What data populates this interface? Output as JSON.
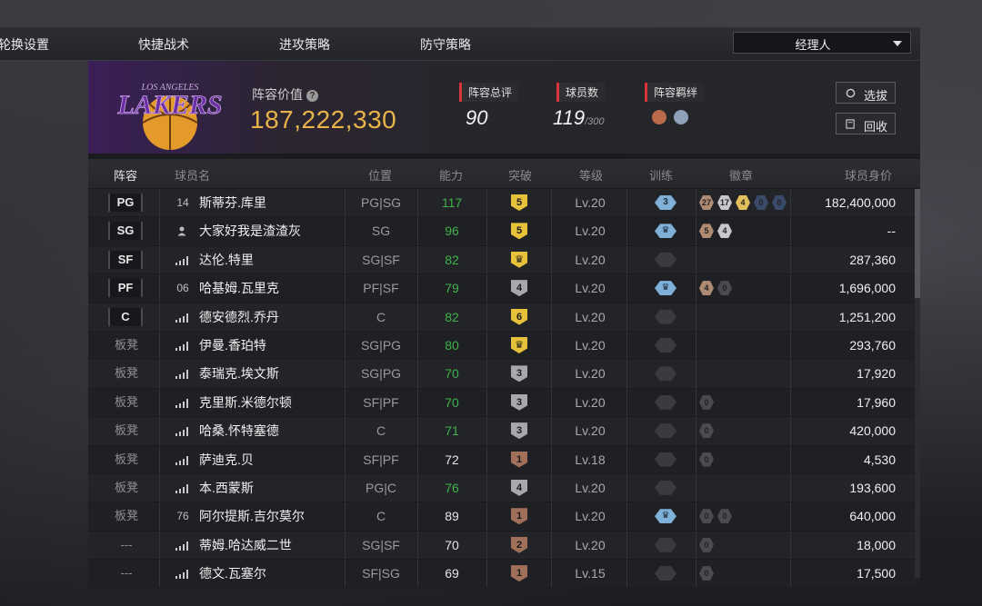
{
  "topnav": {
    "items": [
      "轮换设置",
      "快捷战术",
      "进攻策略",
      "防守策略"
    ],
    "manager_select": "经理人"
  },
  "team": {
    "logo_text": "LAKERS",
    "logo_subtext": "LOS ANGELES",
    "value_label": "阵容价值",
    "value": "187,222,330",
    "stats": [
      {
        "label": "阵容总评",
        "value": "90",
        "suffix": ""
      },
      {
        "label": "球员数",
        "value": "119",
        "suffix": "/300"
      },
      {
        "label": "阵容羁绊",
        "value": "",
        "suffix": ""
      }
    ],
    "buttons": {
      "select": "选拔",
      "recycle": "回收"
    }
  },
  "columns": [
    "阵容",
    "球员名",
    "位置",
    "能力",
    "突破",
    "等级",
    "训练",
    "徽章",
    "球员身价"
  ],
  "players": [
    {
      "slot": "PG",
      "starter": true,
      "icon": "jersey",
      "jersey": "14",
      "name": "斯蒂芬.库里",
      "position": "PG|SG",
      "ability": "117",
      "ability_color": "#3fb24a",
      "breakthrough": "5",
      "bt_color": "#e8c13a",
      "level": "Lv.20",
      "training": "3",
      "badges": [
        {
          "t": "27",
          "c": "#b08b74"
        },
        {
          "t": "17",
          "c": "#c8c8cc"
        },
        {
          "t": "4",
          "c": "#e3c05a"
        },
        {
          "t": "0",
          "c": "#3a4a6a"
        },
        {
          "t": "0",
          "c": "#3a4a6a"
        }
      ],
      "price": "182,400,000"
    },
    {
      "slot": "SG",
      "starter": true,
      "icon": "avatar",
      "jersey": "",
      "name": "大家好我是渣渣灰",
      "position": "SG",
      "ability": "96",
      "ability_color": "#3fb24a",
      "breakthrough": "5",
      "bt_color": "#e8c13a",
      "level": "Lv.20",
      "training": "crown",
      "badges": [
        {
          "t": "5",
          "c": "#b08b74"
        },
        {
          "t": "4",
          "c": "#c8c8cc"
        }
      ],
      "price": "--"
    },
    {
      "slot": "SF",
      "starter": true,
      "icon": "signal",
      "jersey": "",
      "name": "达伦.特里",
      "position": "SG|SF",
      "ability": "82",
      "ability_color": "#3fb24a",
      "breakthrough": "crown",
      "bt_color": "#e8c13a",
      "level": "Lv.20",
      "training": "none",
      "badges": [],
      "price": "287,360"
    },
    {
      "slot": "PF",
      "starter": true,
      "icon": "jersey",
      "jersey": "06",
      "name": "哈基姆.瓦里克",
      "position": "PF|SF",
      "ability": "79",
      "ability_color": "#3fb24a",
      "breakthrough": "4",
      "bt_color": "#a8a8ac",
      "level": "Lv.20",
      "training": "crown",
      "badges": [
        {
          "t": "4",
          "c": "#b08b74"
        },
        {
          "t": "0",
          "c": "#4a4b50"
        }
      ],
      "price": "1,696,000"
    },
    {
      "slot": "C",
      "starter": true,
      "icon": "signal",
      "jersey": "",
      "name": "德安德烈.乔丹",
      "position": "C",
      "ability": "82",
      "ability_color": "#3fb24a",
      "breakthrough": "6",
      "bt_color": "#e8c13a",
      "level": "Lv.20",
      "training": "none",
      "badges": [],
      "price": "1,251,200"
    },
    {
      "slot": "板凳",
      "starter": false,
      "icon": "signal",
      "jersey": "",
      "name": "伊曼.香珀特",
      "position": "SG|PG",
      "ability": "80",
      "ability_color": "#3fb24a",
      "breakthrough": "crown",
      "bt_color": "#e8c13a",
      "level": "Lv.20",
      "training": "none",
      "badges": [],
      "price": "293,760"
    },
    {
      "slot": "板凳",
      "starter": false,
      "icon": "signal",
      "jersey": "",
      "name": "泰瑞克.埃文斯",
      "position": "SG|PG",
      "ability": "70",
      "ability_color": "#3fb24a",
      "breakthrough": "3",
      "bt_color": "#a8a8ac",
      "level": "Lv.20",
      "training": "none",
      "badges": [],
      "price": "17,920"
    },
    {
      "slot": "板凳",
      "starter": false,
      "icon": "signal",
      "jersey": "",
      "name": "克里斯.米德尔顿",
      "position": "SF|PF",
      "ability": "70",
      "ability_color": "#3fb24a",
      "breakthrough": "3",
      "bt_color": "#a8a8ac",
      "level": "Lv.20",
      "training": "none",
      "badges": [
        {
          "t": "0",
          "c": "#4a4b50"
        }
      ],
      "price": "17,960"
    },
    {
      "slot": "板凳",
      "starter": false,
      "icon": "signal",
      "jersey": "",
      "name": "哈桑.怀特塞德",
      "position": "C",
      "ability": "71",
      "ability_color": "#3fb24a",
      "breakthrough": "3",
      "bt_color": "#a8a8ac",
      "level": "Lv.20",
      "training": "none",
      "badges": [
        {
          "t": "0",
          "c": "#4a4b50"
        }
      ],
      "price": "420,000"
    },
    {
      "slot": "板凳",
      "starter": false,
      "icon": "signal",
      "jersey": "",
      "name": "萨迪克.贝",
      "position": "SF|PF",
      "ability": "72",
      "ability_color": "#e6e6e6",
      "breakthrough": "1",
      "bt_color": "#a0705a",
      "level": "Lv.18",
      "training": "none",
      "badges": [
        {
          "t": "0",
          "c": "#4a4b50"
        }
      ],
      "price": "4,530"
    },
    {
      "slot": "板凳",
      "starter": false,
      "icon": "signal",
      "jersey": "",
      "name": "本.西蒙斯",
      "position": "PG|C",
      "ability": "76",
      "ability_color": "#3fb24a",
      "breakthrough": "4",
      "bt_color": "#a8a8ac",
      "level": "Lv.20",
      "training": "none",
      "badges": [],
      "price": "193,600"
    },
    {
      "slot": "板凳",
      "starter": false,
      "icon": "jersey",
      "jersey": "76",
      "name": "阿尔提斯.吉尔莫尔",
      "position": "C",
      "ability": "89",
      "ability_color": "#e6e6e6",
      "breakthrough": "1",
      "bt_color": "#a0705a",
      "level": "Lv.20",
      "training": "crown",
      "badges": [
        {
          "t": "0",
          "c": "#4a4b50"
        },
        {
          "t": "0",
          "c": "#4a4b50"
        }
      ],
      "price": "640,000"
    },
    {
      "slot": "---",
      "starter": false,
      "icon": "signal",
      "jersey": "",
      "name": "蒂姆.哈达威二世",
      "position": "SG|SF",
      "ability": "70",
      "ability_color": "#e6e6e6",
      "breakthrough": "2",
      "bt_color": "#a0705a",
      "level": "Lv.20",
      "training": "none",
      "badges": [
        {
          "t": "0",
          "c": "#4a4b50"
        }
      ],
      "price": "18,000"
    },
    {
      "slot": "---",
      "starter": false,
      "icon": "signal",
      "jersey": "",
      "name": "德文.瓦塞尔",
      "position": "SF|SG",
      "ability": "69",
      "ability_color": "#e6e6e6",
      "breakthrough": "1",
      "bt_color": "#a0705a",
      "level": "Lv.15",
      "training": "none",
      "badges": [
        {
          "t": "0",
          "c": "#4a4b50"
        }
      ],
      "price": "17,500"
    }
  ]
}
